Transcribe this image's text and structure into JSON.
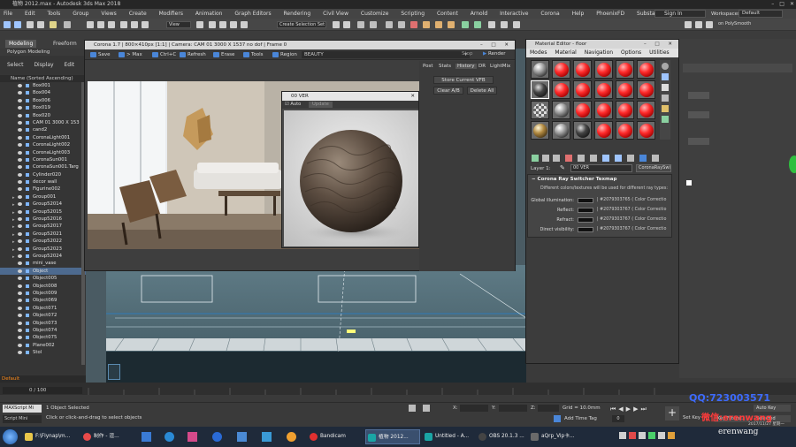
{
  "app": {
    "title": "Autodesk 3ds Max 2018",
    "file_title": "植物 2012.max - Autodesk 3ds Max 2018",
    "menus": [
      "File",
      "Edit",
      "Tools",
      "Group",
      "Views",
      "Create",
      "Modifiers",
      "Animation",
      "Graph Editors",
      "Rendering",
      "Civil View",
      "Customize",
      "Scripting",
      "Content",
      "Arnold",
      "Interactive",
      "Corona",
      "Help",
      "PhoenixFD",
      "Substance"
    ],
    "sign_in": "Sign In",
    "workspaces_label": "Workspaces:",
    "workspace": "Default",
    "selection_set": "Create Selection Set",
    "view_select": "View",
    "polysmooth": "on PolySmooth"
  },
  "ribbon": {
    "tabs": [
      "Modeling",
      "Freeform"
    ],
    "sub": "Polygon Modeling"
  },
  "scene_explorer": {
    "menu": [
      "Select",
      "Display",
      "Edit"
    ],
    "header": "Name (Sorted Ascending)",
    "items": [
      "Box001",
      "Box004",
      "Box006",
      "Box019",
      "Box020",
      "CAM 01 3000 X 153",
      "cand2",
      "CoronaLight001",
      "CoronaLight002",
      "CoronaLight003",
      "CoronaSun001",
      "CoronaSun001.Targ",
      "Cylinder020",
      "decor wall",
      "Figurine002",
      "Group001",
      "Group52014",
      "Group52015",
      "Group52016",
      "Group52017",
      "Group52021",
      "Group52022",
      "Group52023",
      "Group52024",
      "mini_vase",
      "Object",
      "Object005",
      "Object008",
      "Object009",
      "Object069",
      "Object071",
      "Object072",
      "Object073",
      "Object074",
      "Object075",
      "Plane002",
      "Stol"
    ],
    "layer": "Default"
  },
  "vfb": {
    "title": "Corona 1.7 | 800×410px [1:1] | Camera: CAM 01 3000 X 1537 no dof | Frame 0",
    "buttons": [
      "Save",
      "> Max",
      "Ctrl+C",
      "Refresh",
      "Erase",
      "Tools",
      "Region"
    ],
    "pass": "BEAUTY",
    "stop": "Stop",
    "render": "Render",
    "side_tabs": [
      "Post",
      "Stats",
      "History",
      "DR",
      "LightMix"
    ],
    "store_button": "Store Current VFB",
    "clear_ab": "Clear A/B",
    "delete_all": "Delete All"
  },
  "ver_window": {
    "title": "00 VER",
    "auto": "Auto",
    "update": "Update"
  },
  "material_editor": {
    "title": "Material Editor - floor",
    "menus": [
      "Modes",
      "Material",
      "Navigation",
      "Options",
      "Utilities"
    ],
    "layer_label": "Layer 1:",
    "layer_value": "00 VER",
    "type_button": "CoronaRaySwitch",
    "rollout_title": "Corona Ray Switcher Texmap",
    "rollout_desc": "Different colors/textures will be used for different ray types:",
    "rows": [
      {
        "label": "Global illumination:",
        "value": "| #2079303765 ( Color Correctio"
      },
      {
        "label": "Reflect:",
        "value": "| #2079303767 ( Color Correctio"
      },
      {
        "label": "Refract:",
        "value": "| #2079303767 ( Color Correctio"
      },
      {
        "label": "Direct visibility:",
        "value": "| #2079303767 ( Color Correctio"
      }
    ]
  },
  "timeline": {
    "frame": "0 / 100"
  },
  "status": {
    "script_label": "MAXScript Mi",
    "status_top": "1 Object Selected",
    "status_bottom": "Click or click-and-drag to select objects",
    "maxscript": "Script Mini",
    "x_label": "X:",
    "y_label": "Y:",
    "z_label": "Z:",
    "grid": "Grid = 10.0mm",
    "time_tag": "Add Time Tag",
    "set_key": "Set Key",
    "key_filters": "Key Filters...",
    "auto_key": "Auto Key",
    "selected": "Selected",
    "date": "2017/11/27 星期一"
  },
  "taskbar": {
    "items": [
      "F:\\Flynap\\m...",
      "制作 - 渲...",
      "Bandicam",
      "植物 2012...",
      "Untitled - A...",
      "OBS 20.1.3 ...",
      "aQrp_Vip卡..."
    ]
  },
  "watermark": {
    "line1": "QQ:723003571",
    "line2": "微信:erenwang",
    "line3": "erenwang"
  },
  "colors": {
    "accent": "#4a86d8",
    "selection": "#4d6a8f",
    "material_red": "#ff2b2b"
  }
}
